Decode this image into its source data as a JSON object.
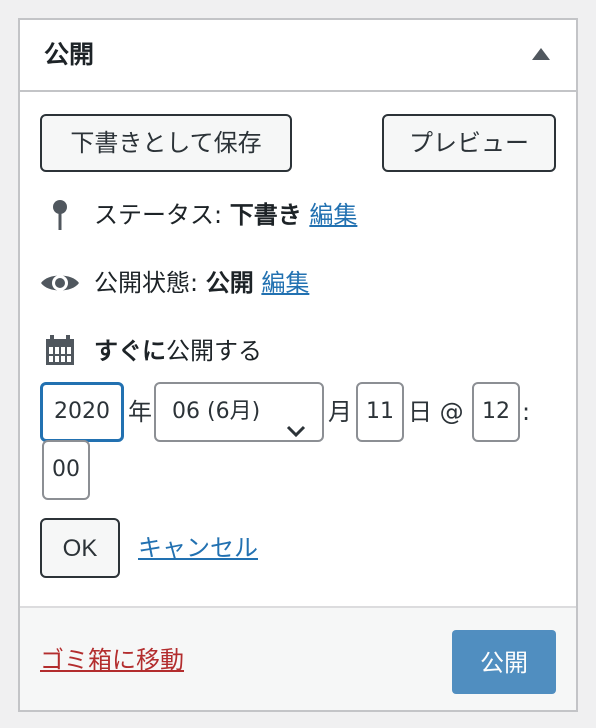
{
  "panel": {
    "title": "公開"
  },
  "actions": {
    "save_draft_label": "下書きとして保存",
    "preview_label": "プレビュー"
  },
  "status": {
    "label": "ステータス:",
    "value": "下書き",
    "edit_label": "編集"
  },
  "visibility": {
    "label": "公開状態:",
    "value": "公開",
    "edit_label": "編集"
  },
  "schedule": {
    "emphasis": "すぐに",
    "label": "公開する",
    "year": "2020",
    "year_suffix": "年",
    "month_selected": "06 (6月)",
    "month_suffix": "月",
    "day": "11",
    "day_suffix": "日 @",
    "hour": "12",
    "colon": ":",
    "minute": "00",
    "ok_label": "OK",
    "cancel_label": "キャンセル"
  },
  "footer": {
    "trash_label": "ゴミ箱に移動",
    "publish_label": "公開"
  },
  "colors": {
    "link": "#2271b1",
    "danger": "#b32d2e",
    "primary": "#2271b1"
  }
}
